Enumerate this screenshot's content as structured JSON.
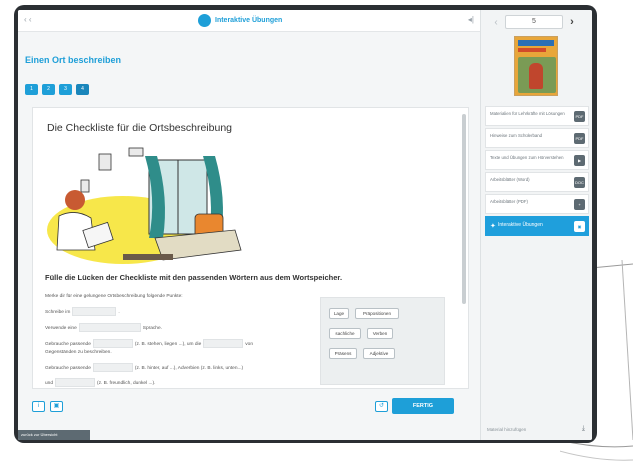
{
  "topbar": {
    "back": "‹ ‹",
    "brand": "Interaktive Übungen",
    "collapse": "◂|"
  },
  "sidebar": {
    "prev": "‹",
    "page": "5",
    "next": "›",
    "items": [
      {
        "label": "Materialien für Lehrkräfte mit Lösungen",
        "badge": "PDF"
      },
      {
        "label": "Hinweise zum Schülerband",
        "badge": "PDF"
      },
      {
        "label": "Texte und Übungen zum Hörverstehen",
        "badge": "▶"
      },
      {
        "label": "Arbeitsblätter (Word)",
        "badge": "DOC"
      },
      {
        "label": "Arbeitsblätter (PDF)",
        "badge": "+"
      }
    ],
    "active_item": {
      "label": "Interaktive Übungen",
      "badge": "▣"
    },
    "footer": "Material hinzufügen"
  },
  "main": {
    "title": "Einen Ort beschreiben",
    "steps": [
      "1",
      "2",
      "3",
      "4"
    ],
    "heading": "Die Checkliste für die Ortsbeschreibung",
    "task": "Fülle die Lücken der Checkliste mit den passenden Wörtern aus dem Wortspeicher.",
    "intro": "Merke dir für eine gelungene Ortsbeschreibung folgende Punkte:",
    "rows": {
      "r1a": "Schreibe im",
      "r1b": ".",
      "r2a": "Verwende eine",
      "r2b": "Sprache.",
      "r3a": "Gebrauche passende",
      "r3b": "(z. B. stehen, liegen ...), um die",
      "r3c": "von",
      "r3d": "Gegenständen zu beschreiben.",
      "r4a": "Gebrauche passende",
      "r4b": "(z. B. hinter, auf ...), Adverbien (z. B. links, unten...)",
      "r5a": "und",
      "r5b": "(z. B. freundlich, dunkel ...)."
    },
    "word_bank": [
      "Lage",
      "Präpositionen",
      "sachliche",
      "Verben",
      "Präsens",
      "Adjektive"
    ],
    "done_button": "FERTIG",
    "back_link": "zurück zur Übersicht"
  }
}
